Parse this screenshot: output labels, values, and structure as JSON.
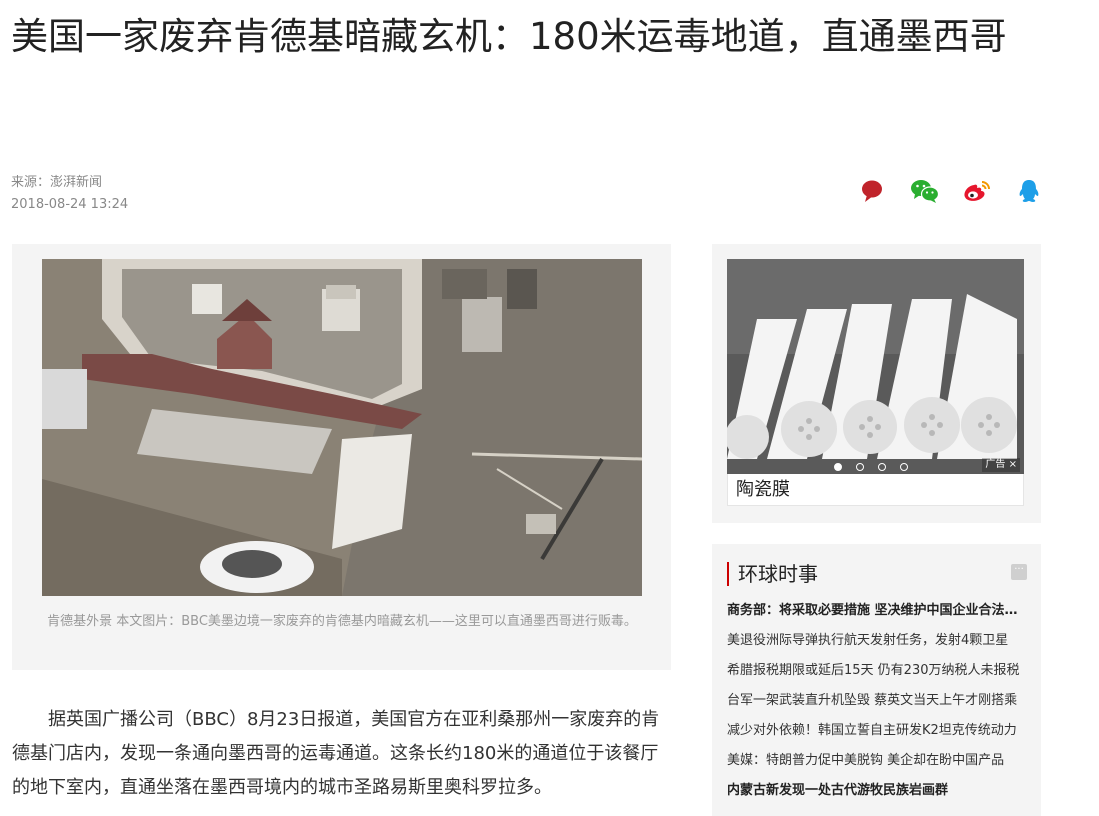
{
  "article": {
    "title": "美国一家废弃肯德基暗藏玄机：180米运毒地道，直通墨西哥",
    "source": "来源：澎湃新闻",
    "datetime": "2018-08-24 13:24",
    "image_caption": "肯德基外景 本文图片：BBC美墨边境一家废弃的肯德基内暗藏玄机——这里可以直通墨西哥进行贩毒。",
    "body": "据英国广播公司（BBC）8月23日报道，美国官方在亚利桑那州一家废弃的肯德基门店内，发现一条通向墨西哥的运毒通道。这条长约180米的通道位于该餐厅的地下室内，直通坐落在墨西哥境内的城市圣路易斯里奥科罗拉多。"
  },
  "share": {
    "icons": [
      "comment-icon",
      "wechat-icon",
      "weibo-icon",
      "qq-icon"
    ],
    "colors": {
      "comment": "#c0242b",
      "wechat": "#2aae30",
      "weibo": "#e6162d",
      "qq": "#1e9fe8"
    }
  },
  "ad": {
    "label": "陶瓷膜",
    "tag": "广告",
    "close": "×",
    "dots_active_index": 0,
    "dots_count": 4
  },
  "sidebar": {
    "title": "环球时事",
    "more": "···",
    "accent": "#c00000",
    "items": [
      {
        "text": "商务部：将采取必要措施 坚决维护中国企业合法权益",
        "bold": true
      },
      {
        "text": "美退役洲际导弹执行航天发射任务，发射4颗卫星",
        "bold": false
      },
      {
        "text": "希腊报税期限或延后15天 仍有230万纳税人未报税",
        "bold": false
      },
      {
        "text": "台军一架武装直升机坠毁 蔡英文当天上午才刚搭乘",
        "bold": false
      },
      {
        "text": "减少对外依赖！韩国立誓自主研发K2坦克传统动力",
        "bold": false
      },
      {
        "text": "美媒：特朗普力促中美脱钩 美企却在盼中国产品",
        "bold": false
      },
      {
        "text": "内蒙古新发现一处古代游牧民族岩画群",
        "bold": true
      }
    ]
  }
}
